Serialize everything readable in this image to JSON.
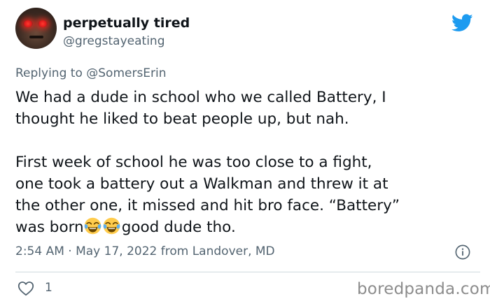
{
  "tweet": {
    "display_name": "perpetually tired",
    "handle": "@gregstayeating",
    "replying_to_prefix": "Replying to ",
    "replying_to_handle": "@SomersErin",
    "body": {
      "line1": "We had a dude in school who we called Battery, I",
      "line2": "thought he liked to beat people up, but nah.",
      "line3": "First week of school he was too close to a fight,",
      "line4": "one took a battery out a Walkman and threw it at",
      "line5": "the other one, it missed and hit bro face. “Battery”",
      "line6_before_emoji": "was born",
      "line6_after_emoji": "good dude tho.",
      "emoji_names": [
        "face-with-tears-of-joy",
        "face-with-tears-of-joy"
      ]
    },
    "timestamp": "2:54 AM · May 17, 2022 from Landover, MD",
    "like_count": "1"
  },
  "icons": {
    "brand": "twitter-bird-icon",
    "info": "info-icon",
    "like": "heart-outline-icon"
  },
  "watermark": "boredpanda.com",
  "colors": {
    "twitter_blue": "#1d9bf0",
    "secondary_text": "#536471",
    "primary_text": "#0f1419",
    "divider": "#cfd9de"
  }
}
